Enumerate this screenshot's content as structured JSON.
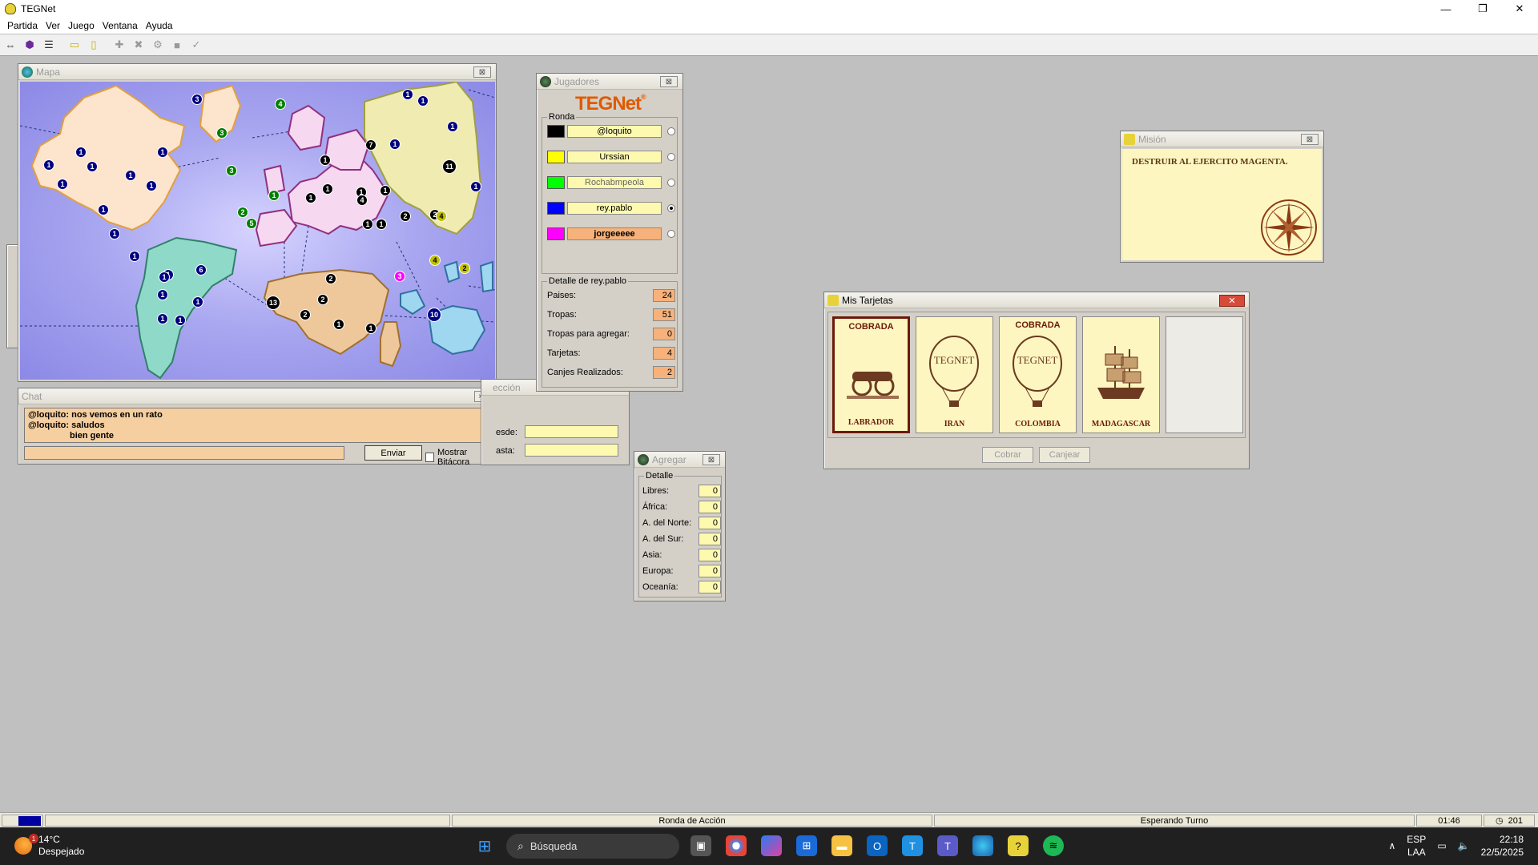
{
  "app": {
    "title": "TEGNet"
  },
  "window_buttons": {
    "minimize": "—",
    "maximize": "❐",
    "close": "✕"
  },
  "menu": [
    "Partida",
    "Ver",
    "Juego",
    "Ventana",
    "Ayuda"
  ],
  "map_window": {
    "title": "Mapa"
  },
  "map_numbers": [
    "1",
    "1",
    "1",
    "1",
    "1",
    "1",
    "1",
    "1",
    "1",
    "3",
    "1",
    "1",
    "1",
    "1",
    "1",
    "1",
    "1",
    "3",
    "3",
    "2",
    "4",
    "7",
    "1",
    "1",
    "1",
    "11",
    "2",
    "4",
    "5",
    "1",
    "1",
    "1",
    "4",
    "1",
    "1",
    "2",
    "1",
    "6",
    "1",
    "1",
    "1",
    "1",
    "13",
    "2",
    "2",
    "2",
    "1",
    "1",
    "3",
    "4",
    "2",
    "10"
  ],
  "chat": {
    "title": "Chat",
    "lines": [
      "@loquito: nos vemos en un rato",
      "@loquito: saludos",
      "bien gente"
    ],
    "send": "Enviar",
    "show_log": "Mostrar Bitácora"
  },
  "direction": {
    "title": "ección",
    "from": "esde:",
    "to": "asta:"
  },
  "players": {
    "title": "Jugadores",
    "logo": "TEGNet",
    "logo_mark": "®",
    "round_label": "Ronda",
    "list": [
      {
        "name": "@loquito",
        "color": "#000000",
        "active": false,
        "bold": false
      },
      {
        "name": "Urssian",
        "color": "#ffff00",
        "active": false,
        "bold": false
      },
      {
        "name": "Rochabmpeola",
        "color": "#00ff00",
        "active": false,
        "bold": false
      },
      {
        "name": "rey.pablo",
        "color": "#0000ff",
        "active": true,
        "bold": false
      },
      {
        "name": "jorgeeeee",
        "color": "#ff00ff",
        "active": false,
        "bold": true
      }
    ],
    "detail_label": "Detalle de rey.pablo",
    "details": [
      {
        "label": "Paises:",
        "value": "24"
      },
      {
        "label": "Tropas:",
        "value": "51"
      },
      {
        "label": "Tropas para agregar:",
        "value": "0"
      },
      {
        "label": "Tarjetas:",
        "value": "4"
      },
      {
        "label": "Canjes Realizados:",
        "value": "2"
      }
    ]
  },
  "add": {
    "title": "Agregar",
    "detail": "Detalle",
    "rows": [
      {
        "label": "Libres:",
        "value": "0"
      },
      {
        "label": "África:",
        "value": "0"
      },
      {
        "label": "A. del Norte:",
        "value": "0"
      },
      {
        "label": "A. del Sur:",
        "value": "0"
      },
      {
        "label": "Asia:",
        "value": "0"
      },
      {
        "label": "Europa:",
        "value": "0"
      },
      {
        "label": "Oceanía:",
        "value": "0"
      }
    ]
  },
  "mission": {
    "title": "Misión",
    "text": "DESTRUIR AL EJERCITO MAGENTA."
  },
  "cards": {
    "title": "Mis Tarjetas",
    "items": [
      {
        "top": "COBRADA",
        "name": "LABRADOR",
        "kind": "cannon",
        "selected": true
      },
      {
        "top": "",
        "name": "IRAN",
        "kind": "balloon",
        "selected": false
      },
      {
        "top": "COBRADA",
        "name": "COLOMBIA",
        "kind": "balloon",
        "selected": false
      },
      {
        "top": "",
        "name": "MADAGASCAR",
        "kind": "ship",
        "selected": false
      }
    ],
    "collect": "Cobrar",
    "exchange": "Canjear"
  },
  "status": {
    "round": "Ronda de Acción",
    "state": "Esperando Turno",
    "time": "01:46",
    "count": "201"
  },
  "taskbar": {
    "weather_temp": "14°C",
    "weather_desc": "Despejado",
    "weather_badge": "1",
    "search": "Búsqueda",
    "lang1": "ESP",
    "lang2": "LAA",
    "time": "22:18",
    "date": "22/5/2025"
  },
  "colors": {
    "player_orange": "#f6b27a",
    "field_yellow": "#fdfab0",
    "taskbar": "#202020"
  }
}
